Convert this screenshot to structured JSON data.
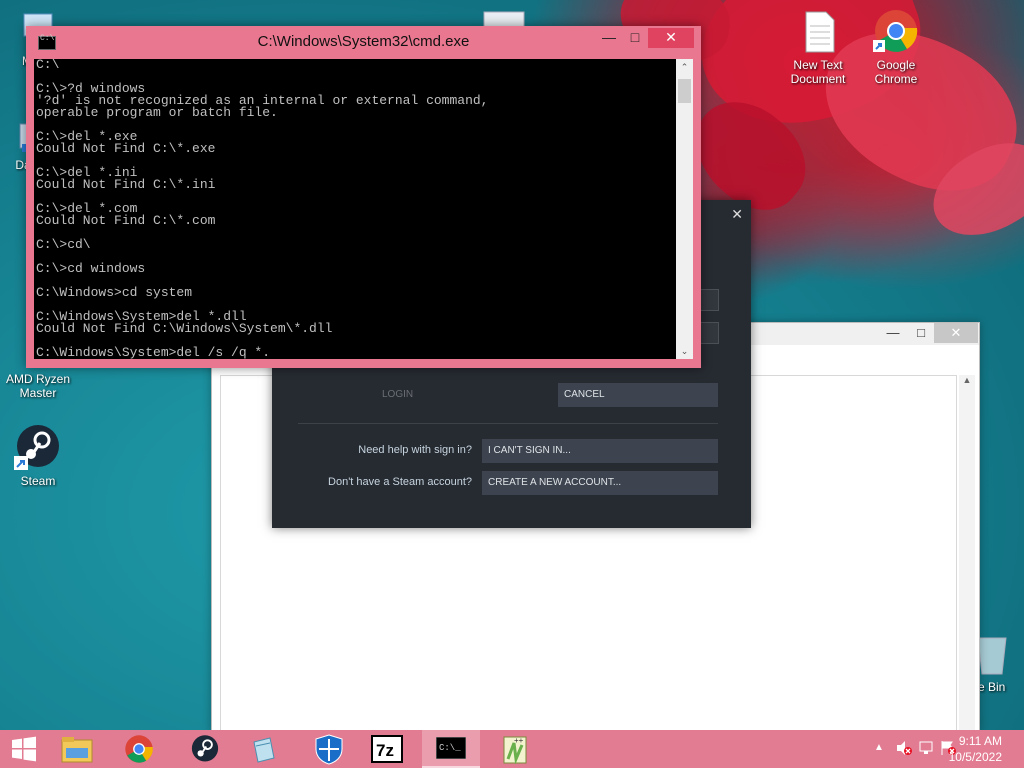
{
  "desktop": {
    "icons": [
      {
        "label": "My C"
      },
      {
        "label": "Data"
      },
      {
        "label": "AMD Ryzen Master"
      },
      {
        "label": "Steam"
      },
      {
        "label": "New Text Document"
      },
      {
        "label": "Google Chrome"
      },
      {
        "label": "e Bin"
      }
    ]
  },
  "cmd": {
    "title": "C:\\Windows\\System32\\cmd.exe",
    "lines": [
      "C:\\",
      "",
      "C:\\>?d windows",
      "'?d' is not recognized as an internal or external command,",
      "operable program or batch file.",
      "",
      "C:\\>del *.exe",
      "Could Not Find C:\\*.exe",
      "",
      "C:\\>del *.ini",
      "Could Not Find C:\\*.ini",
      "",
      "C:\\>del *.com",
      "Could Not Find C:\\*.com",
      "",
      "C:\\>cd\\",
      "",
      "C:\\>cd windows",
      "",
      "C:\\Windows>cd system",
      "",
      "C:\\Windows\\System>del *.dll",
      "Could Not Find C:\\Windows\\System\\*.dll",
      "",
      "C:\\Windows\\System>del /s /q *."
    ]
  },
  "steam": {
    "login_label": "LOGIN",
    "cancel_label": "CANCEL",
    "help_question": "Need help with sign in?",
    "help_button": "I CAN'T SIGN IN...",
    "account_question": "Don't have a Steam account?",
    "account_button": "CREATE A NEW ACCOUNT..."
  },
  "taskbar": {
    "time": "9:11 AM",
    "date": "10/5/2022",
    "items": [
      "start",
      "file-explorer",
      "chrome",
      "steam",
      "notepad",
      "windows-defender",
      "7zip",
      "cmd",
      "notepad-plus-plus"
    ]
  },
  "colors": {
    "cmd_frame": "#e9778f",
    "taskbar": "#e27c92",
    "steam_bg": "#262a31"
  }
}
